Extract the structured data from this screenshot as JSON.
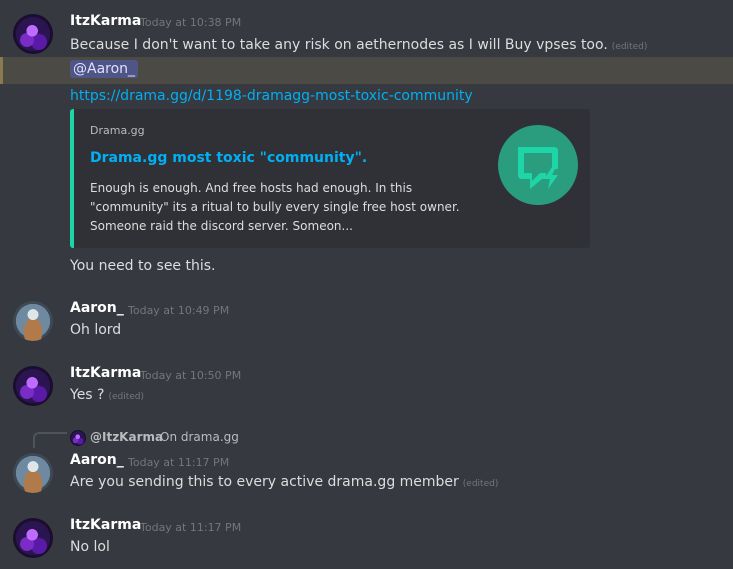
{
  "messages": [
    {
      "author": "ItzKarma",
      "time": "Today at 10:38 PM",
      "text": "Because I don't want to take any risk on aethernodes as I will Buy vpses too.",
      "edited": "(edited)"
    },
    {
      "mention": "@Aaron_",
      "link": "https://drama.gg/d/1198-dramagg-most-toxic-community",
      "embed": {
        "provider": "Drama.gg",
        "title": "Drama.gg most toxic \"community\".",
        "description": "Enough is enough. And free hosts had enough. In this \"community\" its a ritual to bully every single free host owner. Someone raid the discord server. Someon...",
        "accent_color": "#1dd5a6",
        "thumbnail_icon": "chat-bubble-lightning-icon"
      },
      "text2": "You need to see this."
    },
    {
      "author": "Aaron_",
      "time": "Today at 10:49 PM",
      "text": "Oh lord"
    },
    {
      "author": "ItzKarma",
      "time": "Today at 10:50 PM",
      "text": "Yes ?",
      "edited": "(edited)"
    },
    {
      "reply": {
        "name": "@ItzKarma",
        "text": "On drama.gg"
      },
      "author": "Aaron_",
      "time": "Today at 11:17 PM",
      "text": "Are you sending this to every active drama.gg member",
      "edited": "(edited)"
    },
    {
      "author": "ItzKarma",
      "time": "Today at 11:17 PM",
      "text": "No lol"
    }
  ]
}
